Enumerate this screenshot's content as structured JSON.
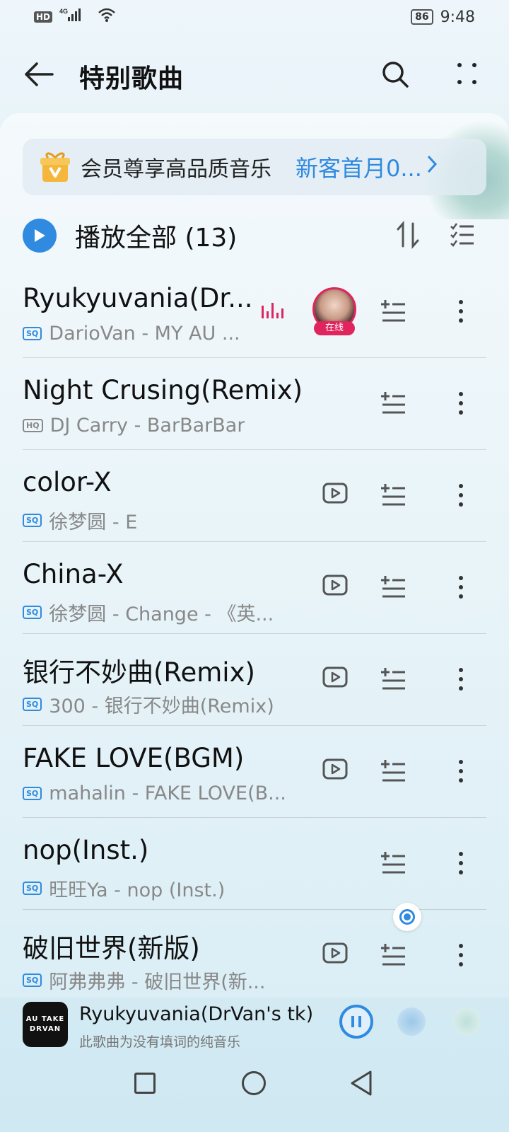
{
  "status_bar": {
    "network": "HD",
    "signal": "4G",
    "battery": "86",
    "time": "9:48"
  },
  "header": {
    "title": "特别歌曲"
  },
  "vip_banner": {
    "text": "会员尊享高品质音乐",
    "offer": "新客首月0..."
  },
  "play_all": {
    "label": "播放全部 (13)"
  },
  "songs": [
    {
      "title": "Ryukyuvania(Dr...",
      "subtitle": "DarioVan - MY AU ...",
      "quality": "SQ",
      "live_tag": "在线"
    },
    {
      "title": "Night Crusing(Remix)",
      "subtitle": "DJ Carry - BarBarBar",
      "quality": "HQ"
    },
    {
      "title": "color-X",
      "subtitle": "徐梦圆 - E",
      "quality": "SQ"
    },
    {
      "title": "China-X",
      "subtitle": "徐梦圆 - Change - 《英...",
      "quality": "SQ"
    },
    {
      "title": "银行不妙曲(Remix)",
      "subtitle": "300 - 银行不妙曲(Remix)",
      "quality": "SQ"
    },
    {
      "title": "FAKE LOVE(BGM)",
      "subtitle": "mahalin - FAKE LOVE(B...",
      "quality": "SQ"
    },
    {
      "title": "nop(Inst.)",
      "subtitle": "旺旺Ya - nop (Inst.)",
      "quality": "SQ"
    },
    {
      "title": "破旧世界(新版)",
      "subtitle": "阿弗弗弗 - 破旧世界(新...",
      "quality": "SQ"
    }
  ],
  "mini_player": {
    "title": "Ryukyuvania(DrVan's tk)",
    "subtitle": "此歌曲为没有填词的纯音乐",
    "cover_line1": "AU TAKE",
    "cover_line2": "DRVAN"
  },
  "colors": {
    "accent": "#2f8ae0",
    "live": "#e0245e"
  }
}
